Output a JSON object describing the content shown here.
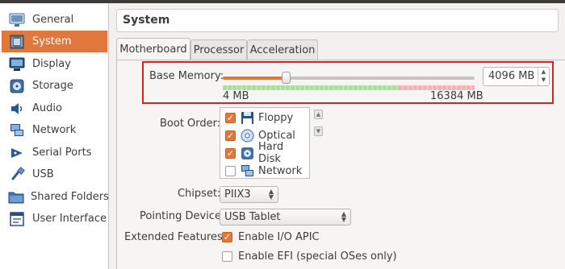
{
  "sidebar": {
    "items": [
      {
        "label": "General",
        "icon": "general-icon",
        "selected": false
      },
      {
        "label": "System",
        "icon": "system-icon",
        "selected": true
      },
      {
        "label": "Display",
        "icon": "display-icon",
        "selected": false
      },
      {
        "label": "Storage",
        "icon": "storage-icon",
        "selected": false
      },
      {
        "label": "Audio",
        "icon": "audio-icon",
        "selected": false
      },
      {
        "label": "Network",
        "icon": "network-icon",
        "selected": false
      },
      {
        "label": "Serial Ports",
        "icon": "serial-ports-icon",
        "selected": false
      },
      {
        "label": "USB",
        "icon": "usb-icon",
        "selected": false
      },
      {
        "label": "Shared Folders",
        "icon": "shared-folders-icon",
        "selected": false
      },
      {
        "label": "User Interface",
        "icon": "user-interface-icon",
        "selected": false
      }
    ]
  },
  "page_title": "System",
  "tabs": [
    {
      "label": "Motherboard",
      "active": true
    },
    {
      "label": "Processor",
      "active": false
    },
    {
      "label": "Acceleration",
      "active": false
    }
  ],
  "base_memory": {
    "label": "Base Memory:",
    "value": "4096 MB",
    "min_label": "4 MB",
    "max_label": "16384 MB",
    "value_mb": 4096,
    "min_mb": 4,
    "max_mb": 16384
  },
  "boot_order": {
    "label": "Boot Order:",
    "items": [
      {
        "label": "Floppy",
        "checked": true,
        "icon": "floppy-icon"
      },
      {
        "label": "Optical",
        "checked": true,
        "icon": "optical-disc-icon"
      },
      {
        "label": "Hard Disk",
        "checked": true,
        "icon": "hard-disk-icon"
      },
      {
        "label": "Network",
        "checked": false,
        "icon": "network-icon"
      }
    ]
  },
  "chipset": {
    "label": "Chipset:",
    "value": "PIIX3"
  },
  "pointing_device": {
    "label": "Pointing Device:",
    "value": "USB Tablet"
  },
  "extended_features": {
    "label": "Extended Features:",
    "options": [
      {
        "label": "Enable I/O APIC",
        "checked": true
      },
      {
        "label": "Enable EFI (special OSes only)",
        "checked": false
      }
    ]
  },
  "colors": {
    "accent": "#e2773e",
    "highlight_border": "#d42323"
  }
}
